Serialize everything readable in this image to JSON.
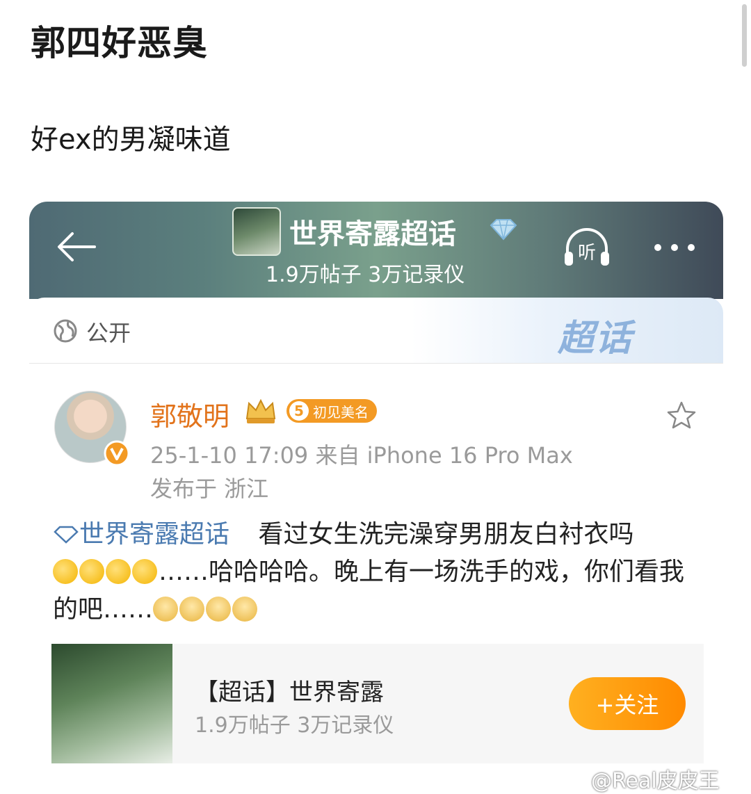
{
  "post": {
    "title": "郭四好恶臭",
    "body": "好ex的男凝味道"
  },
  "screenshot": {
    "header": {
      "topic_name": "世界寄露超话",
      "stats": "1.9万帖子 3万记录仪",
      "listen_label": "听"
    },
    "visibility_label": "公开",
    "watermark": "超话",
    "author": {
      "name": "郭敬明",
      "badge_level": "5",
      "badge_text": "初见美名",
      "meta": "25-1-10 17:09  来自 iPhone 16 Pro Max",
      "location": "发布于 浙江"
    },
    "content": {
      "topic_link": "世界寄露超话",
      "text1": "看过女生洗完澡穿男朋友白衬衣吗",
      "text2": "……哈哈哈哈。晚上有一场洗手的戏，你们看我的吧……"
    },
    "topic_card": {
      "title": "【超话】世界寄露",
      "stats": "1.9万帖子 3万记录仪",
      "follow_label": "+关注"
    }
  },
  "credit": "@Real皮皮王",
  "colors": {
    "username": "#e2731b",
    "topic_link": "#4a7ab0",
    "follow_button": "#ff9a10"
  }
}
